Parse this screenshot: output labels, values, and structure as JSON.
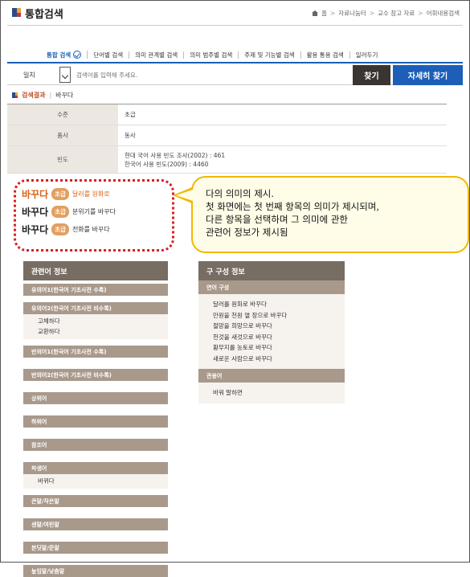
{
  "header": {
    "title": "통합검색",
    "breadcrumb": [
      "홈",
      "자료나눔터",
      "교수 참고 자료",
      "어휘내용검색"
    ]
  },
  "tabs": [
    {
      "label": "통합 검색",
      "active": true
    },
    {
      "label": "단어별 검색",
      "active": false
    },
    {
      "label": "의미 관계별 검색",
      "active": false
    },
    {
      "label": "의미 범주별 검색",
      "active": false
    },
    {
      "label": "주제 및 기능별 검색",
      "active": false
    },
    {
      "label": "활용 통용 검색",
      "active": false
    },
    {
      "label": "일러두기",
      "active": false
    }
  ],
  "search": {
    "select_value": "일치",
    "placeholder": "검색어를 입력해 주세요.",
    "find_label": "찾기",
    "detail_label": "자세히 찾기"
  },
  "result": {
    "label": "검색결과",
    "word": "바꾸다"
  },
  "info": [
    {
      "key": "수준",
      "values": [
        "초급"
      ]
    },
    {
      "key": "품사",
      "values": [
        "동사"
      ]
    },
    {
      "key": "빈도",
      "values": [
        "현대 국어 사용 빈도 조사(2002) : 461",
        "한국어 사용 빈도(2009) : 4460"
      ]
    }
  ],
  "senses": [
    {
      "word": "바꾸다",
      "level": "초급",
      "meaning": "달러를 원화로",
      "active": true
    },
    {
      "word": "바꾸다",
      "level": "초급",
      "meaning": "분위기를 바꾸다",
      "active": false
    },
    {
      "word": "바꾸다",
      "level": "초급",
      "meaning": "전화를 바꾸다",
      "active": false
    }
  ],
  "callout": {
    "lines": [
      "다의 의미의 제시.",
      "첫 화면에는 첫 번째 항목의 의미가 제시되며,",
      "다른 항목을 선택하며 그 의미에 관한",
      "관련어 정보가 제시됨"
    ]
  },
  "related": {
    "title": "관련어 정보",
    "sections": [
      {
        "label": "유의어1(한국어 기초사전 수록)",
        "items": []
      },
      {
        "label": "유의어2(한국어 기초사전 비수록)",
        "items": [
          "고체하다",
          "교환하다"
        ]
      },
      {
        "label": "반의어1(한국어 기초사전 수록)",
        "items": []
      },
      {
        "label": "반의어2(한국어 기초사전 비수록)",
        "items": []
      },
      {
        "label": "상위어",
        "items": []
      },
      {
        "label": "하위어",
        "items": []
      },
      {
        "label": "참조어",
        "items": []
      },
      {
        "label": "파생어",
        "items": [
          "바뀌다"
        ]
      },
      {
        "label": "큰말/작은말",
        "items": []
      },
      {
        "label": "센말/여린말",
        "items": []
      },
      {
        "label": "본딧말/준말",
        "items": []
      },
      {
        "label": "높임말/낮춤말",
        "items": []
      }
    ]
  },
  "phrase": {
    "title": "구 구성 정보",
    "sections": [
      {
        "label": "연어 구성",
        "items": [
          "달러를 원화로 바꾸다",
          "만원을 천원 열 장으로 바꾸다",
          "절망을 희망으로 바꾸다",
          "헌것을 새것으로 바꾸다",
          "황무지를 농토로 바꾸다",
          "새로운 사람으로 바꾸다"
        ]
      },
      {
        "label": "관용어",
        "items": [
          "바꿔 말하면"
        ]
      }
    ]
  }
}
